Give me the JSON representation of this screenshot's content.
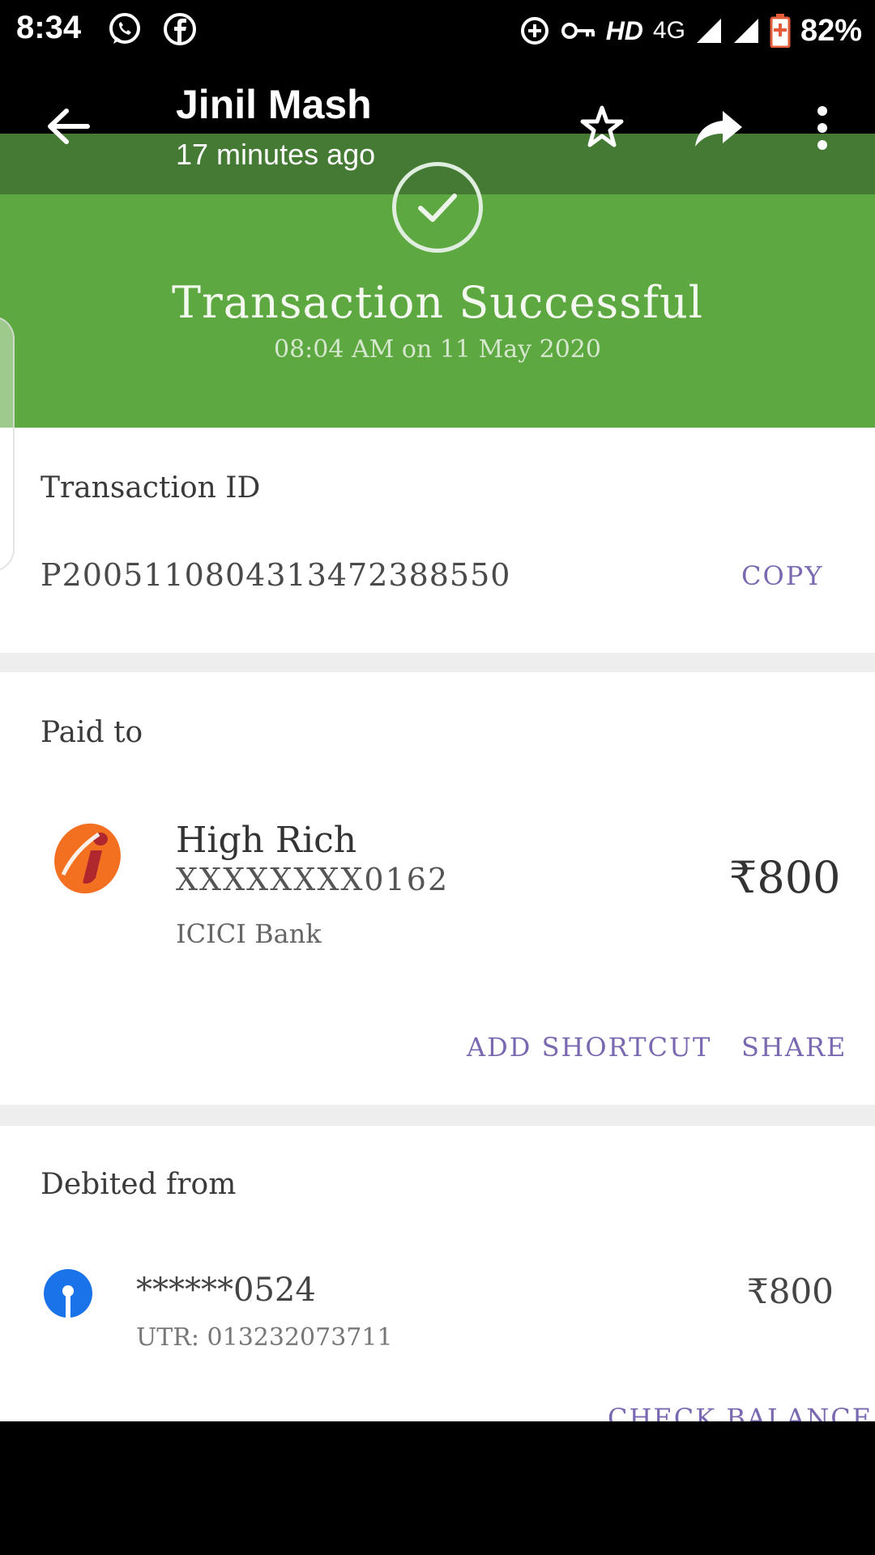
{
  "status_bar": {
    "time": "8:34",
    "network": "HD",
    "network_type": "4G",
    "battery": "82%"
  },
  "toolbar": {
    "title": "Jinil Mash",
    "subtitle": "17 minutes ago"
  },
  "transaction": {
    "status": "Transaction Successful",
    "datetime": "08:04 AM on 11 May 2020",
    "id_label": "Transaction ID",
    "id_value": "P2005110804313472388550",
    "copy_label": "COPY"
  },
  "paid_to": {
    "label": "Paid to",
    "name": "High Rich",
    "account": "XXXXXXXX0162",
    "bank": "ICICI Bank",
    "amount": "₹800",
    "add_shortcut_label": "ADD SHORTCUT",
    "share_label": "SHARE"
  },
  "debited_from": {
    "label": "Debited from",
    "account": "******0524",
    "utr": "UTR: 013232073711",
    "amount": "₹800",
    "check_balance_label": "CHECK BALANCE"
  },
  "colors": {
    "success_green": "#5ea842",
    "action_purple": "#7a69b0",
    "icici_orange": "#f37021",
    "icici_red": "#b0282d",
    "sbi_blue": "#1a73e8"
  }
}
